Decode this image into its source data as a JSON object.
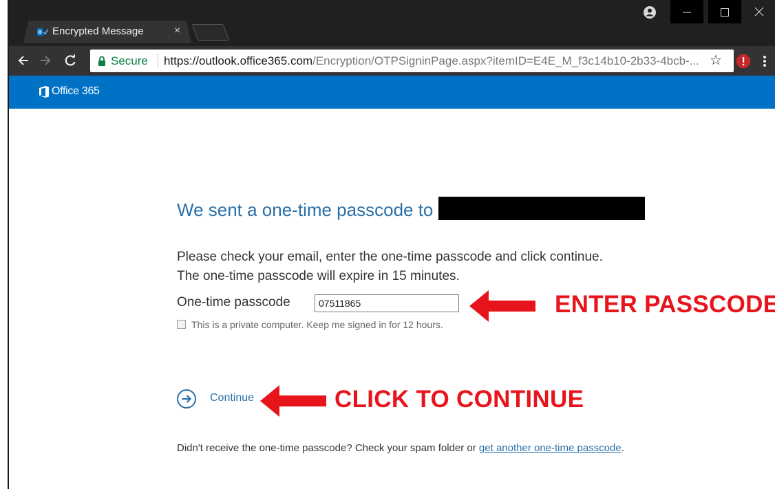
{
  "browser": {
    "tab_title": "Encrypted Message",
    "tab_close": "×",
    "secure_label": "Secure",
    "url_host": "https://outlook.office365.com",
    "url_path": "/Encryption/OTPSigninPage.aspx?itemID=E4E_M_f3c14b10-2b33-4bcb-...",
    "icons": [
      "back-icon",
      "forward-icon",
      "reload-icon",
      "lock-icon",
      "star-icon",
      "extension-icon",
      "menu-icon",
      "profile-icon",
      "minimize-icon",
      "maximize-icon",
      "close-icon"
    ]
  },
  "o365": {
    "brand": "Office 365",
    "brand_color": "#0072c6"
  },
  "main": {
    "heading": "We sent a one-time passcode to",
    "instructions_line1": "Please check your email, enter the one-time passcode and click continue.",
    "instructions_line2": "The one-time passcode will expire in 15 minutes.",
    "otp_label": "One-time passcode",
    "otp_value": "07511865",
    "keep_signed_in_label": "This is a private computer. Keep me signed in for 12 hours.",
    "continue_label": "Continue",
    "footer_text": "Didn't receive the one-time passcode? Check your spam folder or ",
    "footer_link": "get another one-time passcode",
    "footer_end": "."
  },
  "annotations": {
    "enter_passcode": "ENTER PASSCODE",
    "click_to_continue": "CLICK TO CONTINUE",
    "color": "#e8141b"
  }
}
